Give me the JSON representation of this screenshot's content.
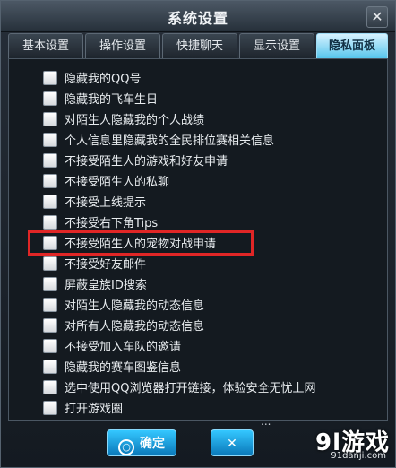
{
  "window": {
    "title": "系统设置",
    "close_glyph": "✕"
  },
  "tabs": [
    {
      "label": "基本设置",
      "active": false
    },
    {
      "label": "操作设置",
      "active": false
    },
    {
      "label": "快捷聊天",
      "active": false
    },
    {
      "label": "显示设置",
      "active": false
    },
    {
      "label": "隐私面板",
      "active": true
    }
  ],
  "privacy_options": [
    {
      "label": "隐藏我的QQ号",
      "checked": false
    },
    {
      "label": "隐藏我的飞车生日",
      "checked": false
    },
    {
      "label": "对陌生人隐藏我的个人战绩",
      "checked": false
    },
    {
      "label": "个人信息里隐藏我的全民排位赛相关信息",
      "checked": false
    },
    {
      "label": "不接受陌生人的游戏和好友申请",
      "checked": false
    },
    {
      "label": "不接受陌生人的私聊",
      "checked": false
    },
    {
      "label": "不接受上线提示",
      "checked": false
    },
    {
      "label": "不接受右下角Tips",
      "checked": false
    },
    {
      "label": "不接受陌生人的宠物对战申请",
      "checked": false,
      "highlighted": true
    },
    {
      "label": "不接受好友邮件",
      "checked": false
    },
    {
      "label": "屏蔽皇族ID搜索",
      "checked": false
    },
    {
      "label": "对陌生人隐藏我的动态信息",
      "checked": false
    },
    {
      "label": "对所有人隐藏我的动态信息",
      "checked": false
    },
    {
      "label": "不接受加入车队的邀请",
      "checked": false
    },
    {
      "label": "隐藏我的赛车图鉴信息",
      "checked": false
    },
    {
      "label": "选中使用QQ浏览器打开链接，体验安全无忧上网",
      "checked": false
    },
    {
      "label": "打开游戏圈",
      "checked": false
    }
  ],
  "footer": {
    "ok_label": "确定",
    "ok_icon": "○",
    "cancel_icon": "✕",
    "partial_text": "..."
  },
  "watermark": {
    "brand": "9l游戏",
    "site": "91danji.com"
  },
  "colors": {
    "active_tab": "#57c5ec",
    "highlight_box": "#e02626",
    "button": "#0a78b9"
  }
}
